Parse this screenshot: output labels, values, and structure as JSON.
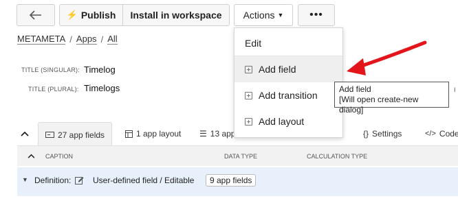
{
  "toolbar": {
    "publish_label": "Publish",
    "install_label": "Install in workspace",
    "actions_label": "Actions",
    "more_label": "•••"
  },
  "breadcrumb": [
    "METAMETA",
    "Apps",
    "All"
  ],
  "breadcrumb_sep": "/",
  "fields": {
    "title_singular_label": "TITLE (SINGULAR):",
    "title_singular_value": "Timelog",
    "title_plural_label": "TITLE (PLURAL):",
    "title_plural_value": "Timelogs",
    "partial_right_char": "I"
  },
  "tabs": {
    "app_fields": "27 app fields",
    "app_layout": "1 app layout",
    "app_partial": "13 app",
    "settings": "Settings",
    "code": "Code"
  },
  "table_header": {
    "caption": "CAPTION",
    "data_type": "DATA TYPE",
    "calculation_type": "CALCULATION TYPE"
  },
  "group_row": {
    "label": "Definition:",
    "value": "User-defined field / Editable",
    "badge": "9 app fields"
  },
  "menu": {
    "items": [
      "Edit",
      "Add field",
      "Add transition",
      "Add layout"
    ]
  },
  "tooltip": {
    "line1": "Add field",
    "line2": "[Will open create-new dialog]"
  },
  "colors": {
    "arrow": "#e3151a",
    "group_row_bg": "#e8f1fb",
    "menu_hover": "#efefef"
  }
}
